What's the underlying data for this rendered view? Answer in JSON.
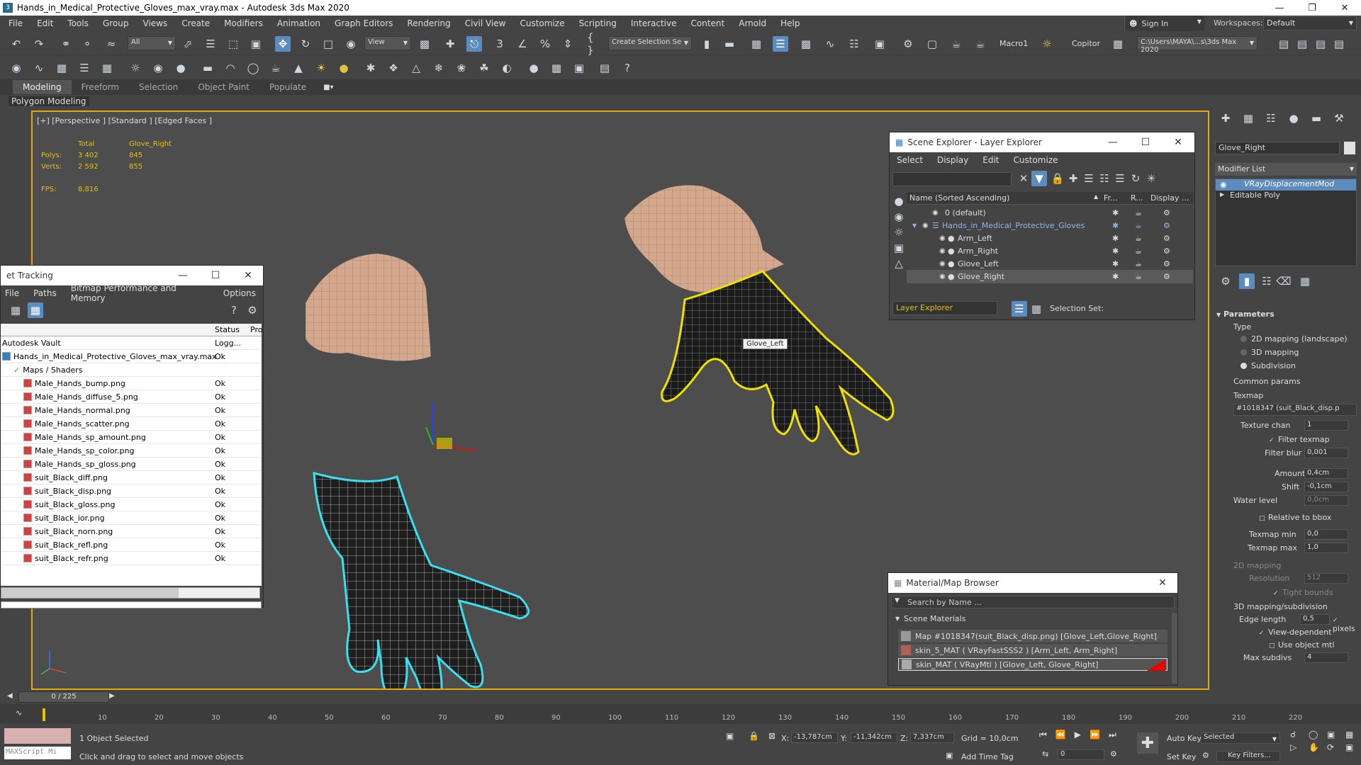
{
  "window": {
    "title": "Hands_in_Medical_Protective_Gloves_max_vray.max - Autodesk 3ds Max 2020"
  },
  "menu": [
    "File",
    "Edit",
    "Tools",
    "Group",
    "Views",
    "Create",
    "Modifiers",
    "Animation",
    "Graph Editors",
    "Rendering",
    "Civil View",
    "Customize",
    "Scripting",
    "Interactive",
    "Content",
    "Arnold",
    "Help"
  ],
  "account": {
    "sign_in": "Sign In",
    "workspaces_label": "Workspaces:",
    "workspace": "Default"
  },
  "toolbar": {
    "selection_filter": "All",
    "ref_coord": "View",
    "selection_set": "Create Selection Se",
    "macro": "Macro1",
    "copitor": "Copitor",
    "project_path": "C:\\Users\\MAYA\\...s\\3ds Max 2020"
  },
  "ribbon": {
    "tabs": [
      "Modeling",
      "Freeform",
      "Selection",
      "Object Paint",
      "Populate"
    ],
    "sub": "Polygon Modeling"
  },
  "viewport": {
    "label": "[+] [Perspective ] [Standard ] [Edged Faces ]",
    "stats": {
      "total_label": "Total",
      "sel_label": "Glove_Right",
      "polys_label": "Polys:",
      "polys_total": "3 402",
      "polys_sel": "845",
      "verts_label": "Verts:",
      "verts_total": "2 592",
      "verts_sel": "855",
      "fps_label": "FPS:",
      "fps": "8,816"
    },
    "tooltip": "Glove_Left"
  },
  "asset_tracking": {
    "title": "et Tracking",
    "menu": [
      "File",
      "Paths",
      "Bitmap Performance and Memory",
      "Options"
    ],
    "col_status": "Status",
    "col_pro": "Pro",
    "vault": "Autodesk Vault",
    "vault_status": "Logg...",
    "file": "Hands_in_Medical_Protective_Gloves_max_vray.max",
    "file_status": "Ok",
    "group": "Maps / Shaders",
    "maps": [
      {
        "name": "Male_Hands_bump.png",
        "status": "Ok"
      },
      {
        "name": "Male_Hands_diffuse_5.png",
        "status": "Ok"
      },
      {
        "name": "Male_Hands_normal.png",
        "status": "Ok"
      },
      {
        "name": "Male_Hands_scatter.png",
        "status": "Ok"
      },
      {
        "name": "Male_Hands_sp_amount.png",
        "status": "Ok"
      },
      {
        "name": "Male_Hands_sp_color.png",
        "status": "Ok"
      },
      {
        "name": "Male_Hands_sp_gloss.png",
        "status": "Ok"
      },
      {
        "name": "suit_Black_diff.png",
        "status": "Ok"
      },
      {
        "name": "suit_Black_disp.png",
        "status": "Ok"
      },
      {
        "name": "suit_Black_gloss.png",
        "status": "Ok"
      },
      {
        "name": "suit_Black_ior.png",
        "status": "Ok"
      },
      {
        "name": "suit_Black_norn.png",
        "status": "Ok"
      },
      {
        "name": "suit_Black_refl.png",
        "status": "Ok"
      },
      {
        "name": "suit_Black_refr.png",
        "status": "Ok"
      }
    ]
  },
  "scene_explorer": {
    "title": "Scene Explorer - Layer Explorer",
    "menu": [
      "Select",
      "Display",
      "Edit",
      "Customize"
    ],
    "col_name": "Name (Sorted Ascending)",
    "col_fr": "Fr...",
    "col_r": "R...",
    "col_disp": "Display ...",
    "rows": [
      {
        "name": "0 (default)"
      },
      {
        "name": "Hands_in_Medical_Protective_Gloves"
      },
      {
        "name": "Arm_Left"
      },
      {
        "name": "Arm_Right"
      },
      {
        "name": "Glove_Left"
      },
      {
        "name": "Glove_Right"
      }
    ],
    "footer_explorer": "Layer Explorer",
    "selection_set": "Selection Set:"
  },
  "material_browser": {
    "title": "Material/Map Browser",
    "search": "Search by Name ...",
    "group": "Scene Materials",
    "items": [
      "Map #1018347(suit_Black_disp.png) [Glove_Left,Glove_Right]",
      "skin_5_MAT  ( VRayFastSSS2 )  [Arm_Left, Arm_Right]",
      "skin_MAT  ( VRayMtl )  [Glove_Left, Glove_Right]"
    ]
  },
  "command_panel": {
    "object_name": "Glove_Right",
    "modifier_list": "Modifier List",
    "stack": [
      "VRayDisplacementMod",
      "Editable Poly"
    ],
    "params_title": "Parameters",
    "type_label": "Type",
    "type_opts": [
      "2D mapping (landscape)",
      "3D mapping",
      "Subdivision"
    ],
    "common_label": "Common params",
    "texmap_label": "Texmap",
    "texmap": "#1018347 (suit_Black_disp.p",
    "texchan_label": "Texture chan",
    "texchan": "1",
    "filter_texmap": "Filter texmap",
    "filter_blur_label": "Filter blur",
    "filter_blur": "0,001",
    "amount_label": "Amount",
    "amount": "0,4cm",
    "shift_label": "Shift",
    "shift": "-0,1cm",
    "water_label": "Water level",
    "water": "0,0cm",
    "relative": "Relative to bbox",
    "texmin_label": "Texmap min",
    "texmin": "0,0",
    "texmax_label": "Texmap max",
    "texmax": "1,0",
    "map2d_label": "2D mapping",
    "resolution_label": "Resolution",
    "resolution": "512",
    "tight": "Tight bounds",
    "map3d_label": "3D mapping/subdivision",
    "edge_label": "Edge length",
    "edge": "0,5",
    "pixels": "pixels",
    "viewdep": "View-dependent",
    "useobj": "Use object mtl",
    "maxsub_label": "Max subdivs",
    "maxsub": "4"
  },
  "timeline": {
    "frame": "0 / 225",
    "ticks": [
      "10",
      "20",
      "30",
      "40",
      "50",
      "60",
      "70",
      "80",
      "90",
      "100",
      "110",
      "120",
      "130",
      "140",
      "150",
      "160",
      "170",
      "180",
      "190",
      "200",
      "210",
      "220"
    ]
  },
  "status": {
    "maxscript": "MAXScript Mi",
    "selected": "1 Object Selected",
    "hint": "Click and drag to select and move objects",
    "x_label": "X:",
    "x": "-13,787cm",
    "y_label": "Y:",
    "y": "-11,342cm",
    "z_label": "Z:",
    "z": "7,337cm",
    "grid": "Grid = 10,0cm",
    "add_time_tag": "Add Time Tag",
    "auto_key": "Auto Key",
    "selected_dd": "Selected",
    "set_key": "Set Key",
    "key_filters": "Key Filters...",
    "frame_val": "0"
  },
  "colors": {
    "accent": "#5c8bbd",
    "viewport_border": "#e6a70a",
    "glove_left_outline": "#f0e200",
    "glove_right_outline": "#39e0f0",
    "stats": "#e6c000"
  }
}
